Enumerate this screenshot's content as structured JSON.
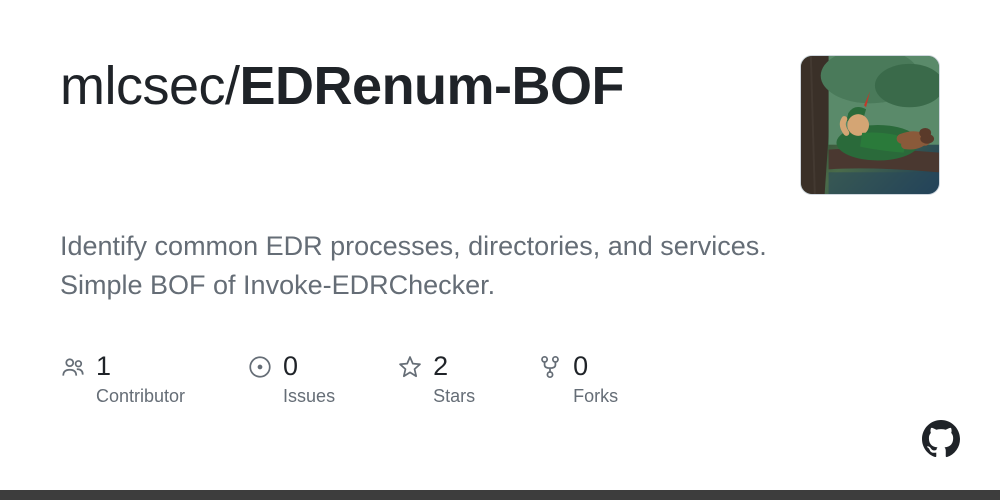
{
  "repo": {
    "owner": "mlcsec",
    "separator": "/",
    "name": "EDRenum-BOF",
    "description": "Identify common EDR processes, directories, and services. Simple BOF of Invoke-EDRChecker."
  },
  "stats": {
    "contributors": {
      "value": "1",
      "label": "Contributor"
    },
    "issues": {
      "value": "0",
      "label": "Issues"
    },
    "stars": {
      "value": "2",
      "label": "Stars"
    },
    "forks": {
      "value": "0",
      "label": "Forks"
    }
  },
  "icons": {
    "contributors": "people-icon",
    "issues": "issue-icon",
    "stars": "star-icon",
    "forks": "fork-icon",
    "github": "github-icon"
  }
}
